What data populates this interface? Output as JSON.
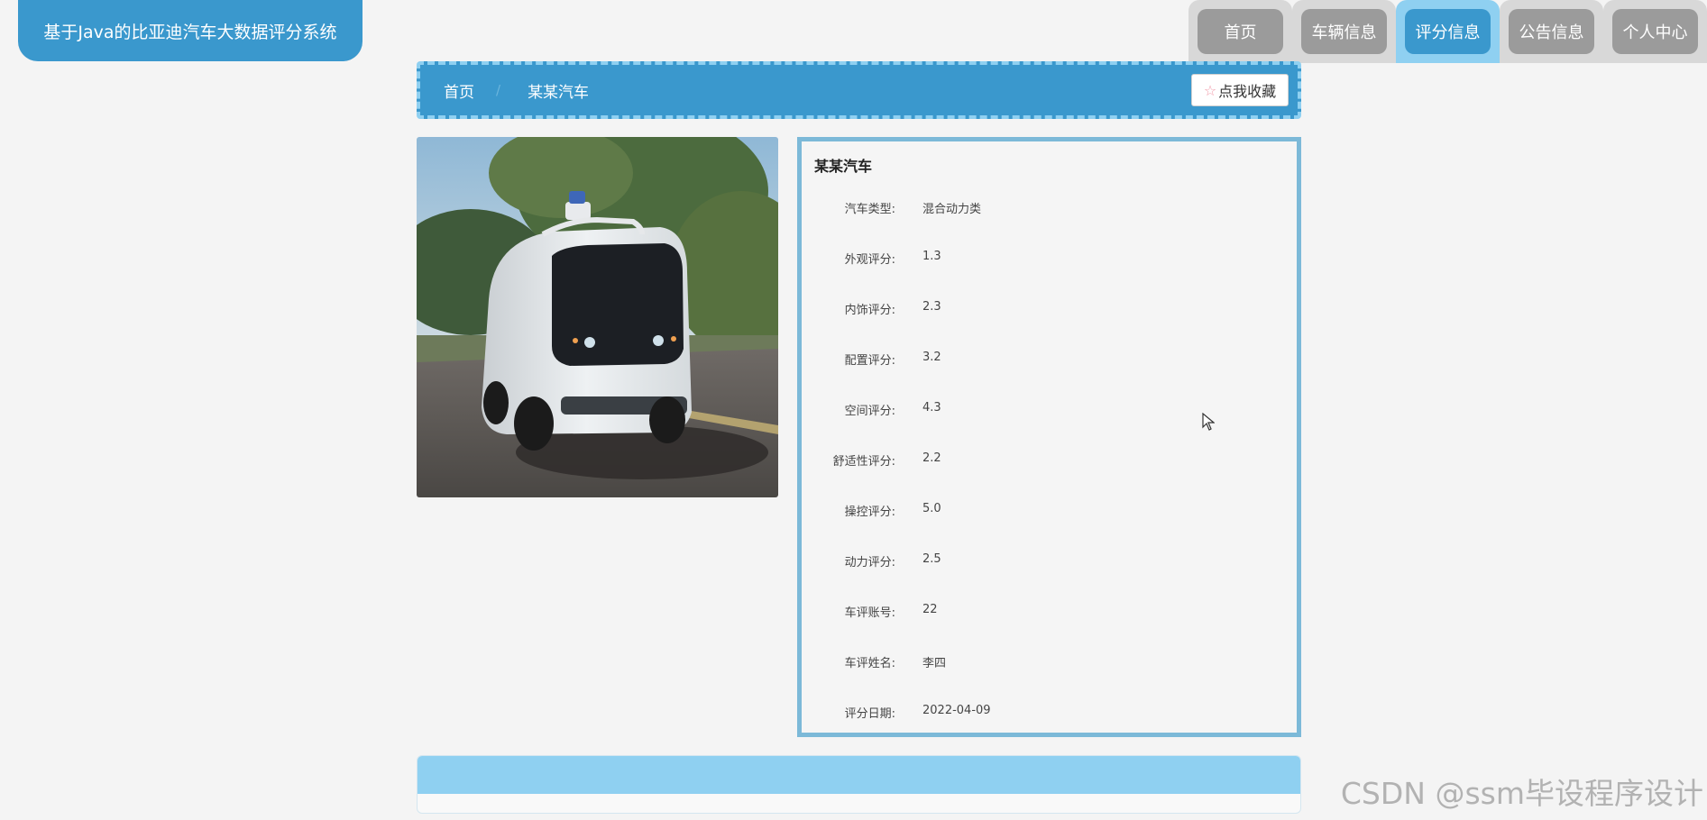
{
  "brand": {
    "title": "基于Java的比亚迪汽车大数据评分系统"
  },
  "nav": {
    "tabs": [
      {
        "label": "首页",
        "active": false
      },
      {
        "label": "车辆信息",
        "active": false
      },
      {
        "label": "评分信息",
        "active": true
      },
      {
        "label": "公告信息",
        "active": false
      },
      {
        "label": "个人中心",
        "active": false
      }
    ]
  },
  "breadcrumb": {
    "home": "首页",
    "separator": "/",
    "current": "某某汽车",
    "favorite_icon": "star-outline-icon",
    "favorite_label": "点我收藏"
  },
  "detail": {
    "title": "某某汽车",
    "fields": [
      {
        "label": "汽车类型:",
        "value": "混合动力类"
      },
      {
        "label": "外观评分:",
        "value": "1.3"
      },
      {
        "label": "内饰评分:",
        "value": "2.3"
      },
      {
        "label": "配置评分:",
        "value": "3.2"
      },
      {
        "label": "空间评分:",
        "value": "4.3"
      },
      {
        "label": "舒适性评分:",
        "value": "2.2"
      },
      {
        "label": "操控评分:",
        "value": "5.0"
      },
      {
        "label": "动力评分:",
        "value": "2.5"
      },
      {
        "label": "车评账号:",
        "value": "22"
      },
      {
        "label": "车评姓名:",
        "value": "李四"
      },
      {
        "label": "评分日期:",
        "value": "2022-04-09"
      }
    ]
  },
  "watermark": "CSDN @ssm毕设程序设计",
  "colors": {
    "primary": "#3a98cd",
    "light": "#8fd0f1",
    "panel_border": "#7cb9d8",
    "tab_inactive": "#9b9b9b"
  }
}
